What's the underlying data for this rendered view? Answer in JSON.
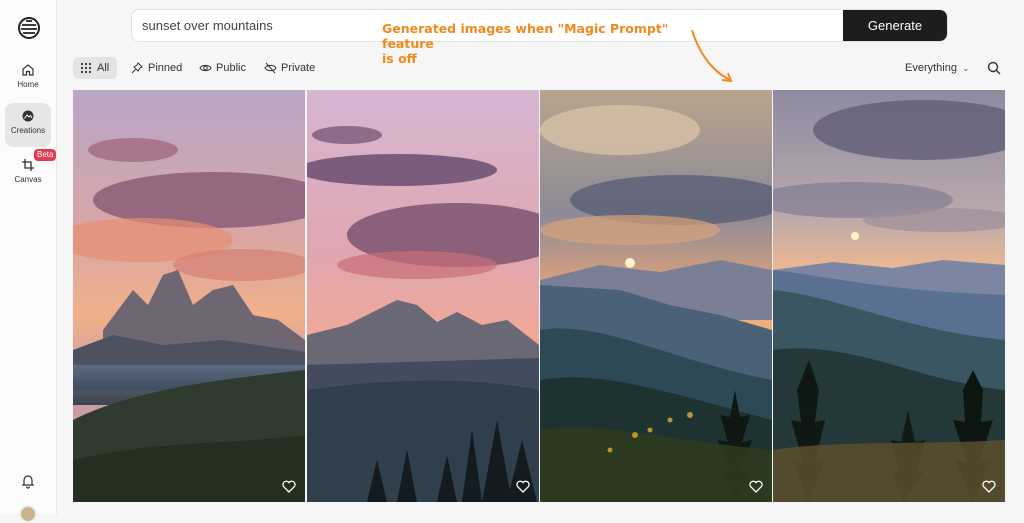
{
  "sidebar": {
    "items": [
      {
        "label": "Home",
        "icon": "home-icon"
      },
      {
        "label": "Creations",
        "icon": "creations-icon",
        "active": true
      },
      {
        "label": "Canvas",
        "icon": "canvas-icon",
        "badge": "Beta"
      }
    ]
  },
  "search": {
    "value": "sunset over mountains",
    "button_label": "Generate"
  },
  "annotation": {
    "line1": "Generated images when \"Magic Prompt\" feature",
    "line2": "is off"
  },
  "filters": {
    "tabs": [
      {
        "label": "All",
        "icon": "grid-icon",
        "active": true
      },
      {
        "label": "Pinned",
        "icon": "pin-icon"
      },
      {
        "label": "Public",
        "icon": "eye-icon"
      },
      {
        "label": "Private",
        "icon": "eye-off-icon"
      }
    ],
    "scope_select": "Everything"
  },
  "colors": {
    "accent_annotation": "#f08a1c",
    "generate_button": "#1d1d1f",
    "beta_badge": "#e23b4e"
  },
  "images": [
    {
      "description": "pink clouds over jagged peaks",
      "icon": "heart-icon"
    },
    {
      "description": "purple clouds over rocky ridge",
      "icon": "heart-icon"
    },
    {
      "description": "sun setting over blue valley with pines",
      "icon": "heart-icon"
    },
    {
      "description": "sunset over layered hills with pines",
      "icon": "heart-icon"
    }
  ]
}
